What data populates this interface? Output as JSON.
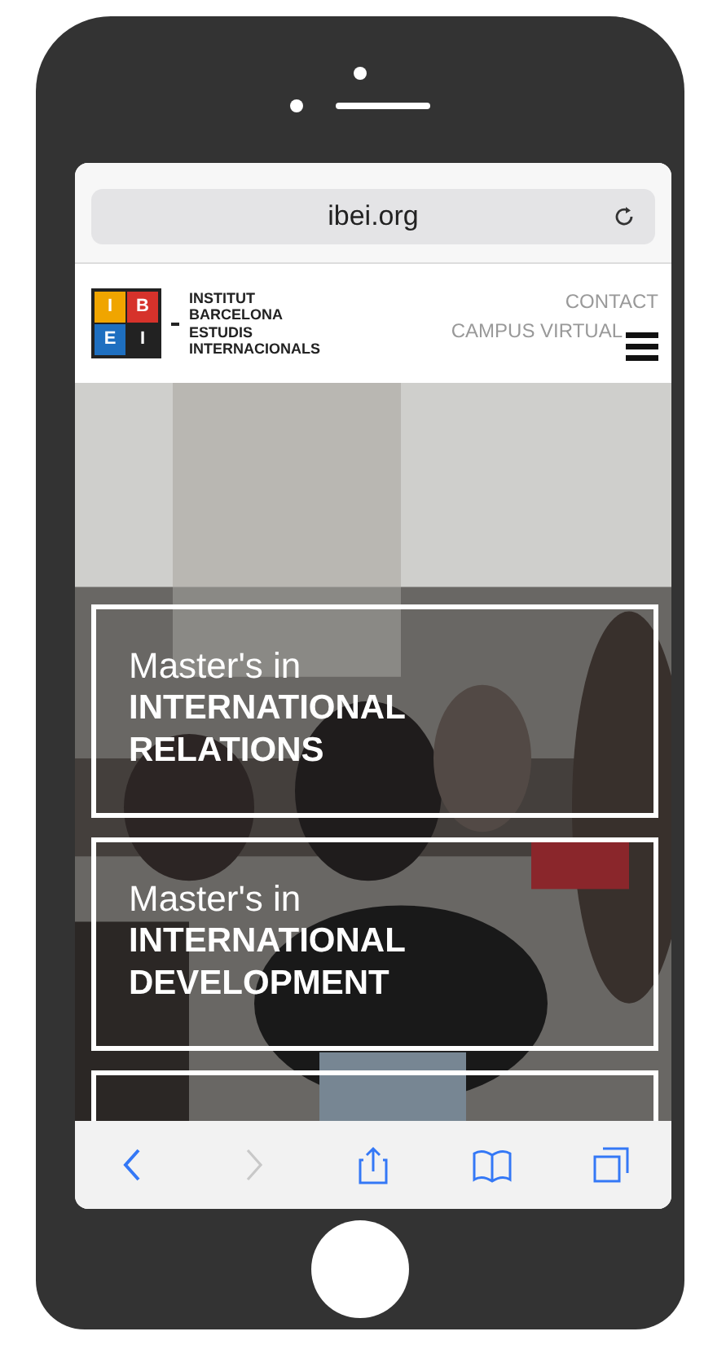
{
  "browser": {
    "address": "ibei.org"
  },
  "header": {
    "logo_letters": [
      "I",
      "B",
      "E",
      "I"
    ],
    "logo_text": [
      "INSTITUT",
      "BARCELONA",
      "ESTUDIS",
      "INTERNACIONALS"
    ],
    "links": [
      "CONTACT",
      "CAMPUS VIRTUAL"
    ]
  },
  "programs": [
    {
      "kind": "full",
      "prefix": "Master's in",
      "title": [
        "INTERNATIONAL",
        "RELATIONS"
      ]
    },
    {
      "kind": "full",
      "prefix": "Master's in",
      "title": [
        "INTERNATIONAL",
        "DEVELOPMENT"
      ]
    },
    {
      "kind": "cut"
    }
  ],
  "toolbar": [
    {
      "kind": "back",
      "disabled": false
    },
    {
      "kind": "forward",
      "disabled": true
    },
    {
      "kind": "share",
      "disabled": false
    },
    {
      "kind": "bookmarks",
      "disabled": false
    },
    {
      "kind": "tabs",
      "disabled": false
    }
  ]
}
